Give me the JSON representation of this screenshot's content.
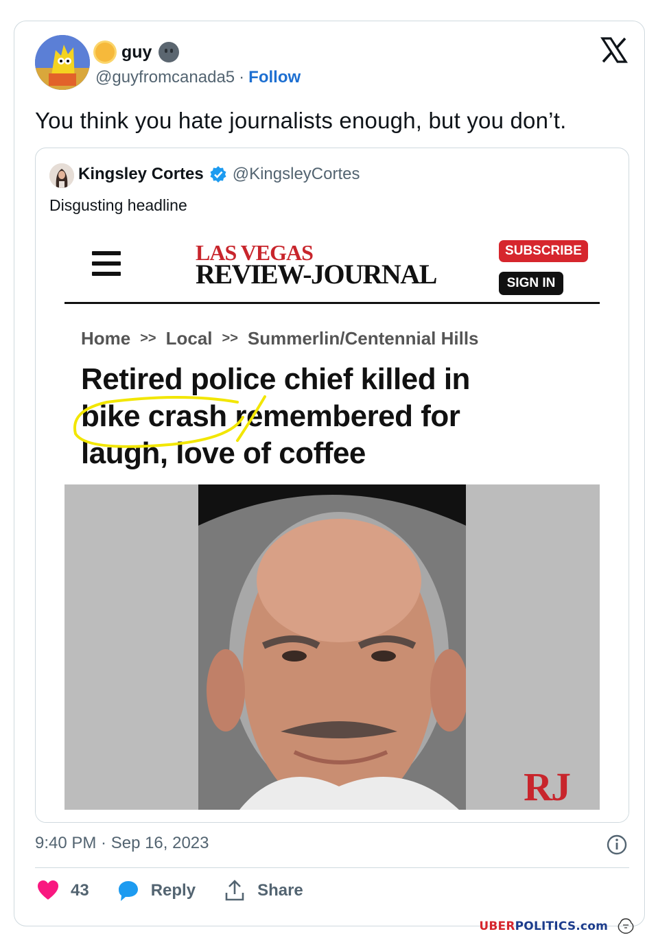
{
  "tweet": {
    "display_name": "guy",
    "handle": "@guyfromcanada5",
    "separator": "·",
    "follow_label": "Follow",
    "text": "You think you hate journalists enough, but you don’t.",
    "timestamp": "9:40 PM · Sep 16, 2023",
    "like_count": "43",
    "reply_label": "Reply",
    "share_label": "Share"
  },
  "quote": {
    "display_name": "Kingsley Cortes",
    "handle": "@KingsleyCortes",
    "text": "Disgusting headline"
  },
  "article": {
    "masthead_top": "LAS VEGAS",
    "masthead_bottom": "REVIEW-JOURNAL",
    "subscribe_label": "SUBSCRIBE",
    "signin_label": "SIGN IN",
    "breadcrumb": [
      "Home",
      "Local",
      "Summerlin/Centennial Hills"
    ],
    "breadcrumb_sep": ">>",
    "headline_line1": "Retired police chief killed in",
    "headline_line2": "bike crash remembered for",
    "headline_line3": "laugh, love of coffee",
    "logo": "RJ"
  },
  "watermark": {
    "part1": "UBER",
    "part2": "POLITICS.com"
  },
  "colors": {
    "link_blue": "#1d6fd1",
    "like_pink": "#f91880",
    "reply_blue": "#1d9bf0",
    "rj_red": "#c8252c",
    "highlight_yellow": "#f2e600"
  }
}
